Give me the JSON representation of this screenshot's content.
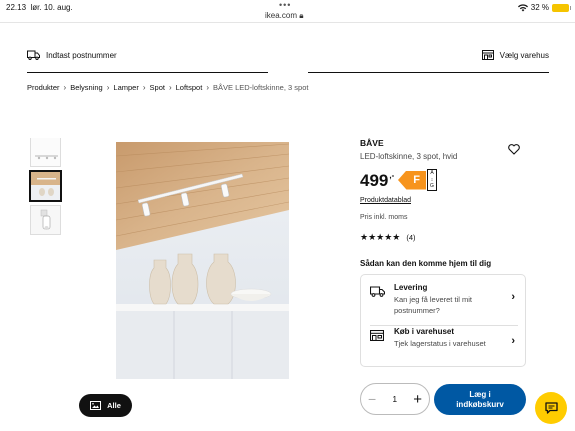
{
  "status_bar": {
    "time": "22.13",
    "date": "lør. 10. aug.",
    "url": "ikea.com",
    "dots": "•••",
    "battery": "32 %"
  },
  "top_bar": {
    "postcode_label": "Indtast postnummer",
    "store_label": "Vælg varehus"
  },
  "breadcrumb": [
    "Produkter",
    "Belysning",
    "Lamper",
    "Spot",
    "Loftspot",
    "BÅVE LED-loftskinne, 3 spot"
  ],
  "gallery": {
    "all_button": "Alle",
    "thumbnail_count": 3,
    "active_thumbnail": 1
  },
  "product": {
    "name": "BÅVE",
    "description": "LED-loftskinne, 3 spot, hvid",
    "price": "499",
    "price_suffix": ",-",
    "energy_class": "F",
    "energy_scale_top": "A",
    "energy_scale_bottom": "G",
    "datasheet_link": "Produktdatablad",
    "vat_note": "Pris inkl. moms",
    "rating_stars": "★★★★★",
    "rating_value": 5,
    "review_count": "(4)"
  },
  "delivery": {
    "heading": "Sådan kan den komme hjem til dig",
    "options": [
      {
        "title": "Levering",
        "subtitle": "Kan jeg få leveret til mit postnummer?",
        "icon": "truck-icon"
      },
      {
        "title": "Køb i varehuset",
        "subtitle": "Tjek lagerstatus i varehuset",
        "icon": "store-icon"
      }
    ]
  },
  "purchase": {
    "quantity": "1",
    "minus": "−",
    "plus": "+",
    "cart_line1": "Læg i",
    "cart_line2": "indkøbskurv"
  },
  "colors": {
    "accent_blue": "#0058a3",
    "chat_yellow": "#ffcc00",
    "energy_orange": "#f7941d"
  }
}
